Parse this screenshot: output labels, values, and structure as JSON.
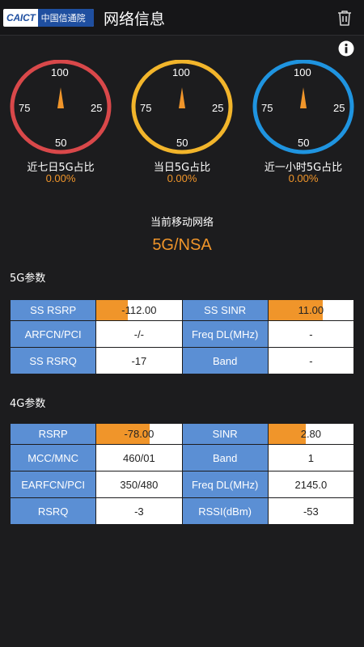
{
  "header": {
    "logo_en": "CAICT",
    "logo_cn": "中国信通院",
    "title": "网络信息",
    "trash_icon": "trash-icon",
    "info_icon": "info-icon"
  },
  "gauges": [
    {
      "label": "近七日5G占比",
      "value": "0.00%",
      "color": "#d9484a",
      "ticks": {
        "top": "100",
        "left": "75",
        "right": "25",
        "bottom": "50"
      }
    },
    {
      "label": "当日5G占比",
      "value": "0.00%",
      "color": "#f2b52b",
      "ticks": {
        "top": "100",
        "left": "75",
        "right": "25",
        "bottom": "50"
      }
    },
    {
      "label": "近一小时5G占比",
      "value": "0.00%",
      "color": "#1f94e0",
      "ticks": {
        "top": "100",
        "left": "75",
        "right": "25",
        "bottom": "50"
      }
    }
  ],
  "network": {
    "label": "当前移动网络",
    "value": "5G/NSA"
  },
  "nr": {
    "section_title": "5G参数",
    "rsrp_label": "SS RSRP",
    "rsrp_value": "-112.00",
    "rsrp_level": 0.37,
    "sinr_label": "SS SINR",
    "sinr_value": "11.00",
    "sinr_level": 0.64,
    "arfcn_label": "ARFCN/PCI",
    "arfcn_value": "-/-",
    "freq_label": "Freq DL(MHz)",
    "freq_value": "-",
    "rsrq_label": "SS RSRQ",
    "rsrq_value": "-17",
    "band_label": "Band",
    "band_value": "-"
  },
  "lte": {
    "section_title": "4G参数",
    "rsrp_label": "RSRP",
    "rsrp_value": "-78.00",
    "rsrp_level": 0.62,
    "sinr_label": "SINR",
    "sinr_value": "2.80",
    "sinr_level": 0.44,
    "mcc_label": "MCC/MNC",
    "mcc_value": "460/01",
    "band_label": "Band",
    "band_value": "1",
    "earfcn_label": "EARFCN/PCI",
    "earfcn_value": "350/480",
    "freq_label": "Freq DL(MHz)",
    "freq_value": "2145.0",
    "rsrq_label": "RSRQ",
    "rsrq_value": "-3",
    "rssi_label": "RSSI(dBm)",
    "rssi_value": "-53"
  }
}
